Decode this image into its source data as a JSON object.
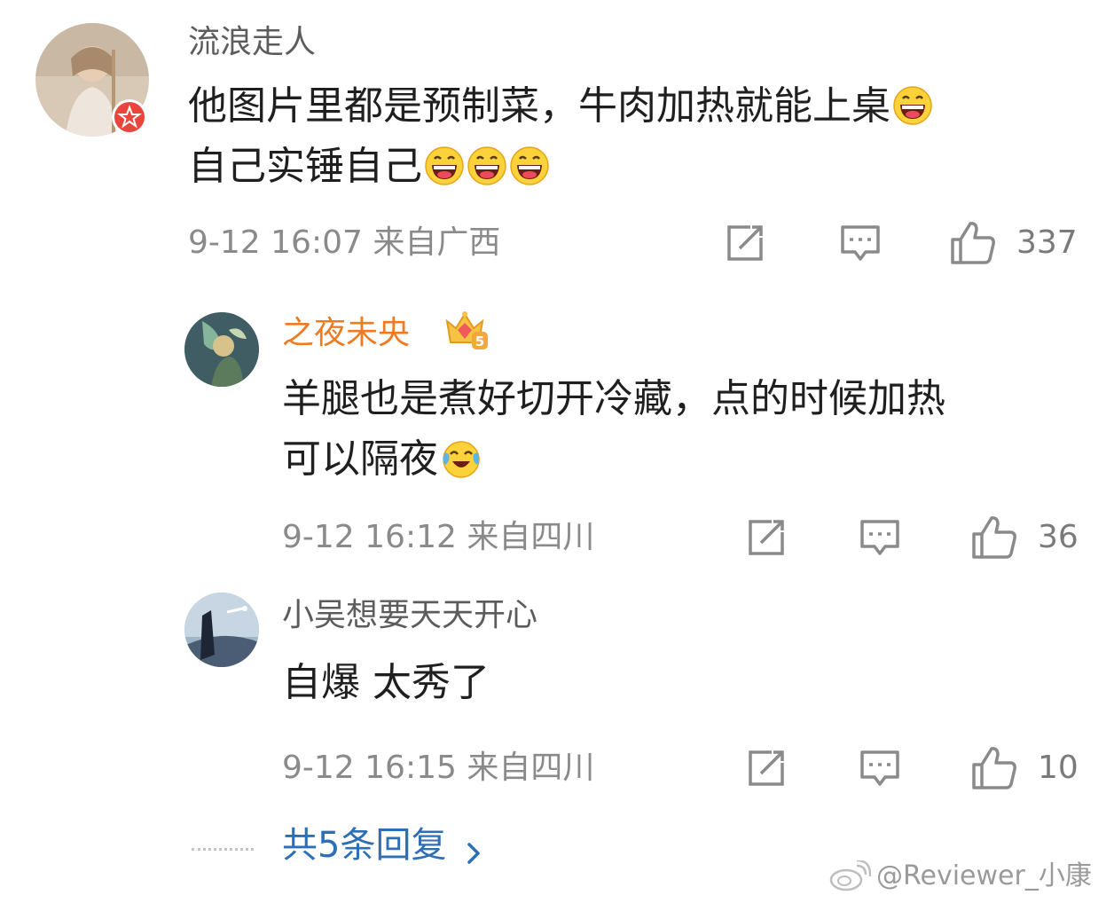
{
  "comments": [
    {
      "username": "流浪走人",
      "text_line1": "他图片里都是预制菜，牛肉加热就能上桌",
      "text_line2": "自己实锤自己",
      "meta": "9-12 16:07 来自广西",
      "likes": "337",
      "badge_icon": "red-star-badge-icon"
    },
    {
      "username": "之夜未央",
      "text_line1": "羊腿也是煮好切开冷藏，点的时候加热",
      "text_line2": "可以隔夜",
      "meta": "9-12 16:12 来自四川",
      "likes": "36",
      "badge_icon": "crown-vip-icon"
    },
    {
      "username": "小吴想要天天开心",
      "text_line1": "自爆 太秀了",
      "meta": "9-12 16:15 来自四川",
      "likes": "10"
    }
  ],
  "more_replies": "共5条回复",
  "more_replies_arrow": "chevron-right-icon",
  "watermark": "@Reviewer_小康",
  "colors": {
    "vip_username": "#ef7a22",
    "link_blue": "#2c6fb5",
    "meta_gray": "#8a8a8a"
  }
}
